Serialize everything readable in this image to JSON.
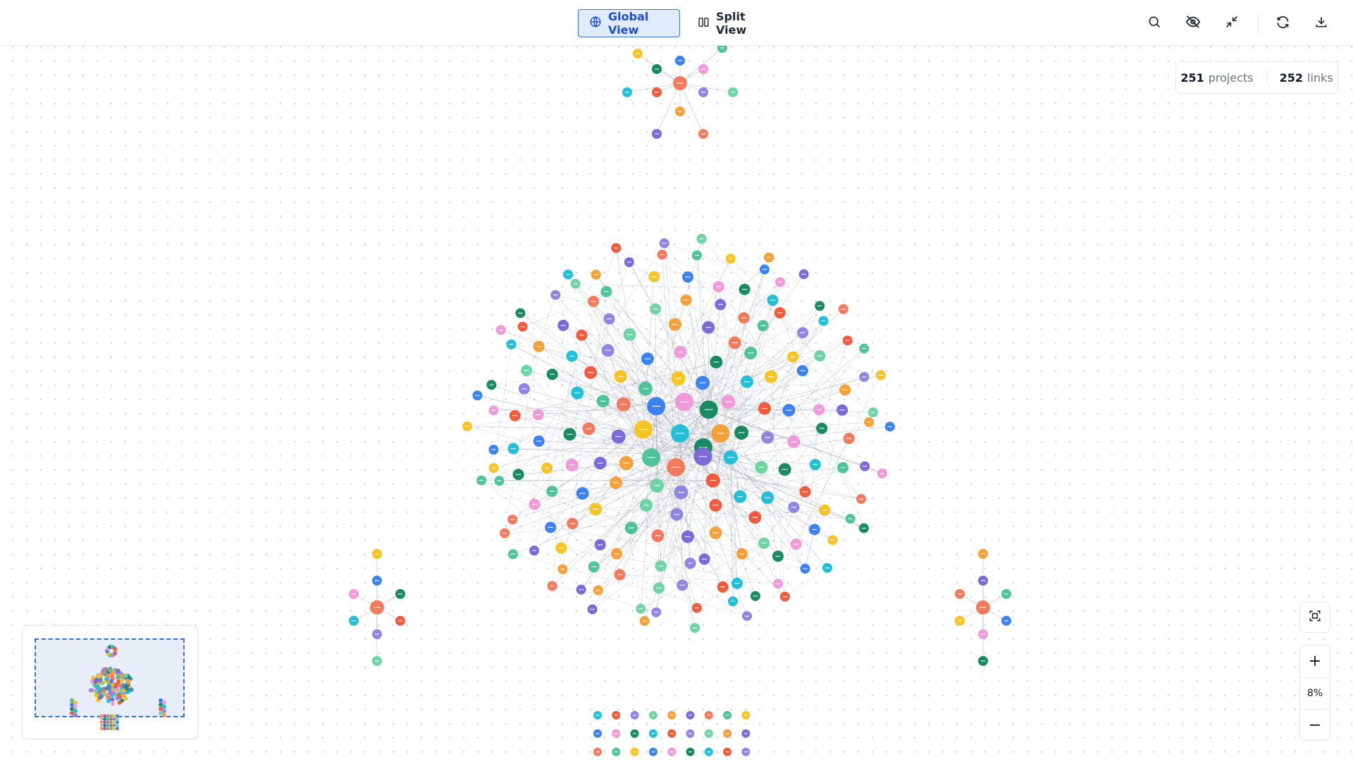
{
  "header": {
    "global_view_label": "Global View",
    "split_view_label": "Split View"
  },
  "toolbar": {
    "icons": [
      "search-icon",
      "eye-off-icon",
      "collapse-icon",
      "refresh-icon",
      "download-icon"
    ]
  },
  "stats": {
    "projects_count": "251",
    "projects_label": "projects",
    "links_count": "252",
    "links_label": "links"
  },
  "zoom": {
    "level": "8%",
    "plus": "+",
    "minus": "−"
  },
  "colors": {
    "accent": "#3b6fd4",
    "node_palette": [
      "#f4a03b",
      "#7c6bd6",
      "#f27a5e",
      "#4fc39a",
      "#f7c325",
      "#3d82f0",
      "#f09ad9",
      "#1a8a63",
      "#23bfd6",
      "#f05b3d",
      "#8e86e0",
      "#6fd4a4"
    ]
  }
}
